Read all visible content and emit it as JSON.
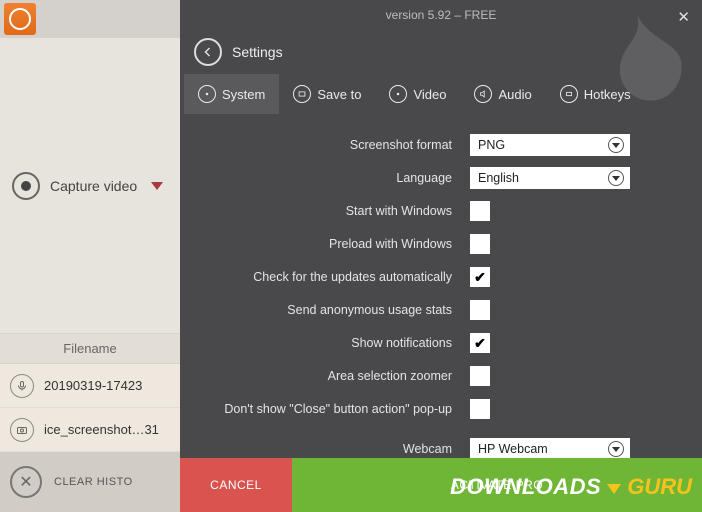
{
  "app": {
    "version_line": "version 5.92 – FREE"
  },
  "sidebar": {
    "capture_label": "Capture video",
    "filename_header": "Filename",
    "files": [
      {
        "name": "20190319-17423",
        "icon": "mic"
      },
      {
        "name": "ice_screenshot…31",
        "icon": "camera"
      }
    ],
    "clear_history_label": "CLEAR HISTO"
  },
  "settings": {
    "title": "Settings",
    "tabs": [
      {
        "key": "system",
        "label": "System"
      },
      {
        "key": "saveto",
        "label": "Save to"
      },
      {
        "key": "video",
        "label": "Video"
      },
      {
        "key": "audio",
        "label": "Audio"
      },
      {
        "key": "hotkeys",
        "label": "Hotkeys"
      }
    ],
    "active_tab": "system",
    "rows": {
      "screenshot_format": {
        "label": "Screenshot format",
        "value": "PNG"
      },
      "language": {
        "label": "Language",
        "value": "English"
      },
      "start_with_windows": {
        "label": "Start with Windows",
        "checked": false
      },
      "preload_with_windows": {
        "label": "Preload with Windows",
        "checked": false
      },
      "check_updates": {
        "label": "Check for the updates automatically",
        "checked": true
      },
      "usage_stats": {
        "label": "Send anonymous usage stats",
        "checked": false
      },
      "show_notifications": {
        "label": "Show notifications",
        "checked": true
      },
      "area_zoomer": {
        "label": "Area selection zoomer",
        "checked": false
      },
      "dont_show_close": {
        "label": "Don't show \"Close\" button action\" pop-up",
        "checked": false
      },
      "webcam": {
        "label": "Webcam",
        "value": "HP Webcam"
      }
    },
    "footer": {
      "cancel": "CANCEL",
      "activate": "ACTIVATE PRO"
    },
    "brand": {
      "left": "DOWNLOADS",
      "right": "GURU"
    }
  }
}
